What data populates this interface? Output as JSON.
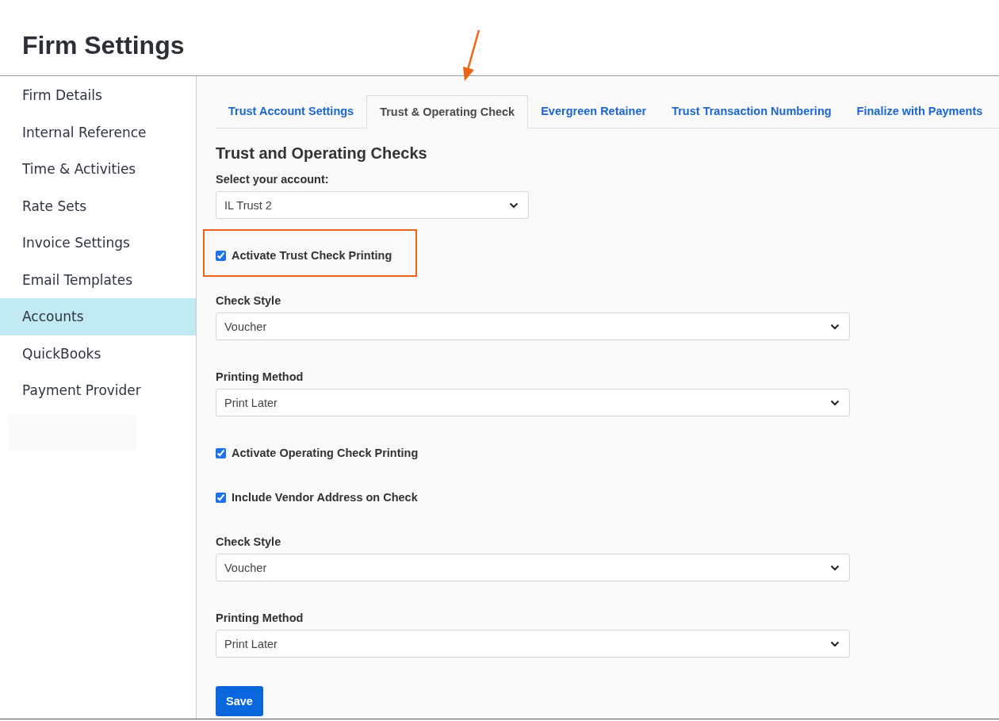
{
  "page": {
    "title": "Firm Settings"
  },
  "sidebar": {
    "items": [
      {
        "label": "Firm Details",
        "selected": false
      },
      {
        "label": "Internal Reference",
        "selected": false
      },
      {
        "label": "Time & Activities",
        "selected": false
      },
      {
        "label": "Rate Sets",
        "selected": false
      },
      {
        "label": "Invoice Settings",
        "selected": false
      },
      {
        "label": "Email Templates",
        "selected": false
      },
      {
        "label": "Accounts",
        "selected": true
      },
      {
        "label": "QuickBooks",
        "selected": false
      },
      {
        "label": "Payment Provider",
        "selected": false
      }
    ]
  },
  "tabs": [
    {
      "label": "Trust Account Settings",
      "selected": false,
      "pointed": false
    },
    {
      "label": "Trust & Operating Check",
      "selected": true,
      "pointed": true
    },
    {
      "label": "Evergreen Retainer",
      "selected": false,
      "pointed": false
    },
    {
      "label": "Trust Transaction Numbering",
      "selected": false,
      "pointed": false
    },
    {
      "label": "Finalize with Payments",
      "selected": false,
      "pointed": false
    }
  ],
  "form": {
    "heading": "Trust and Operating Checks",
    "items": [
      {
        "kind": "account-select",
        "label": "Select your account:",
        "value": "IL Trust 2"
      },
      {
        "kind": "checkbox",
        "label": "Activate Trust Check Printing",
        "checked": true,
        "highlighted": true
      },
      {
        "kind": "select",
        "label": "Check Style",
        "value": "Voucher"
      },
      {
        "kind": "select",
        "label": "Printing Method",
        "value": "Print Later"
      },
      {
        "kind": "checkbox",
        "label": "Activate Operating Check Printing",
        "checked": true,
        "highlighted": false
      },
      {
        "kind": "checkbox",
        "label": "Include Vendor Address on Check",
        "checked": true,
        "highlighted": false
      },
      {
        "kind": "select",
        "label": "Check Style",
        "value": "Voucher"
      },
      {
        "kind": "select",
        "label": "Printing Method",
        "value": "Print Later"
      }
    ],
    "save_button": "Save"
  }
}
